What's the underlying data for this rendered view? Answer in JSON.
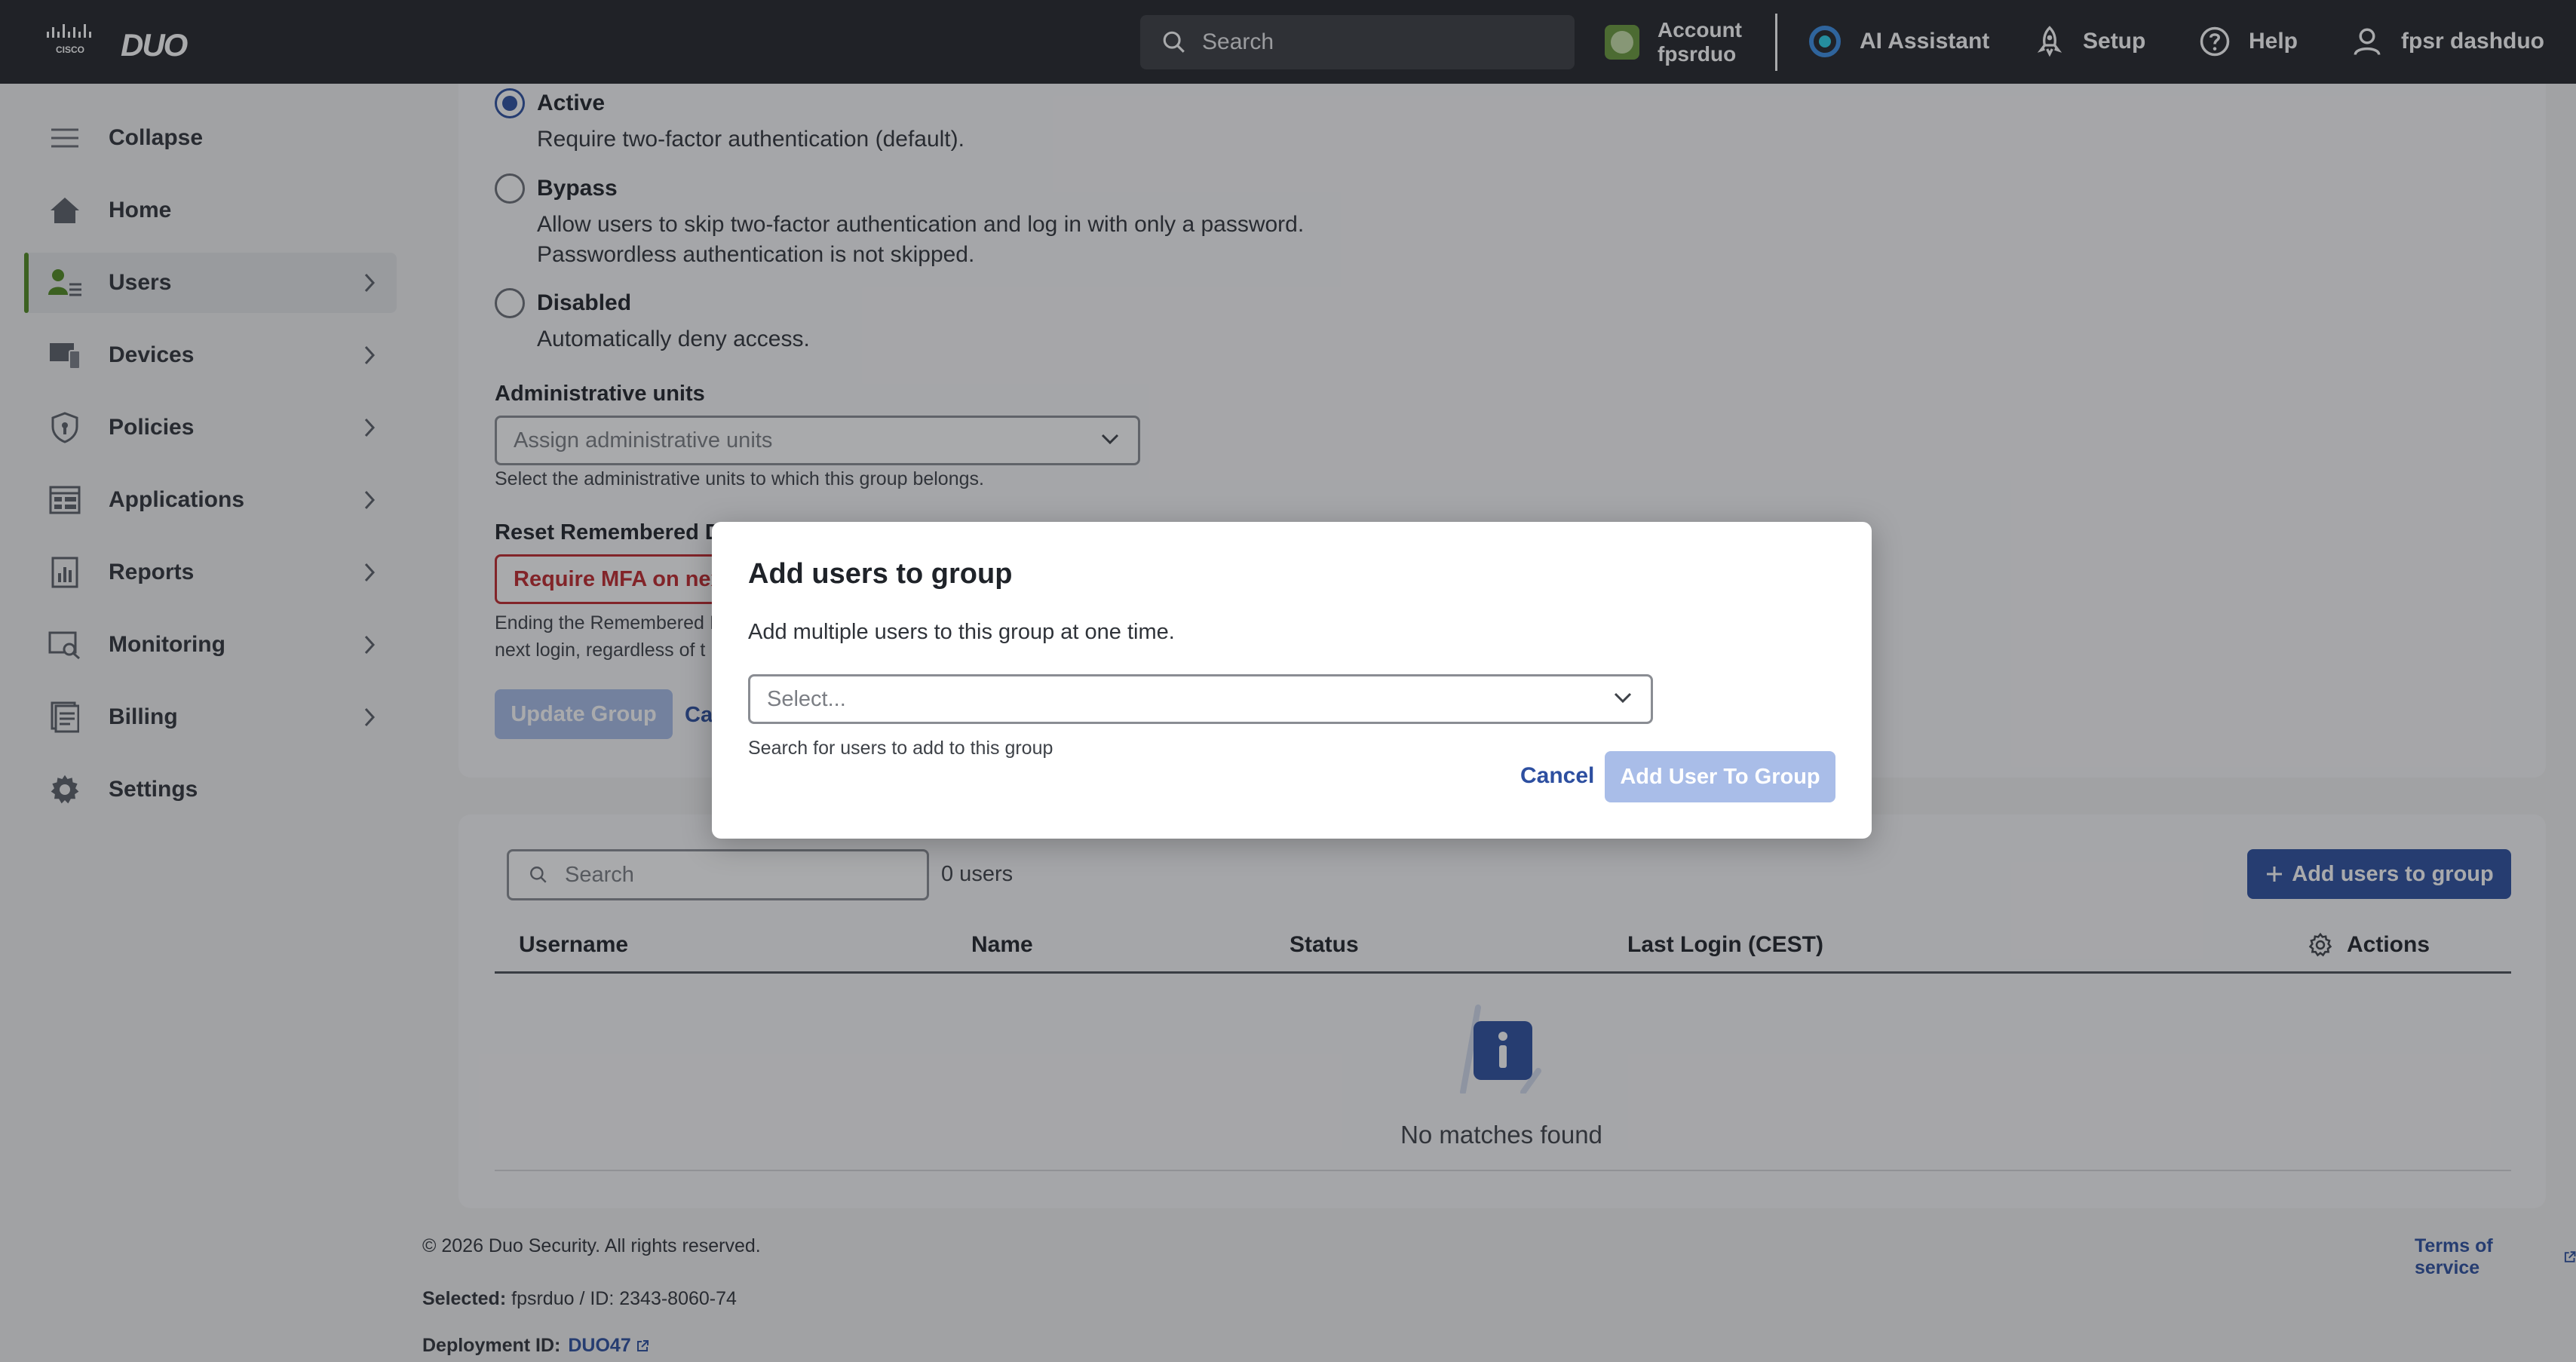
{
  "header": {
    "brand": "DUO",
    "search_placeholder": "Search",
    "account_label": "Account",
    "account_name": "fpsrduo",
    "ai_assistant": "AI Assistant",
    "setup": "Setup",
    "help": "Help",
    "user": "fpsr dashduo"
  },
  "sidebar": {
    "items": [
      {
        "label": "Collapse",
        "icon": "menu-icon"
      },
      {
        "label": "Home",
        "icon": "home-icon"
      },
      {
        "label": "Users",
        "icon": "users-icon",
        "active": true
      },
      {
        "label": "Devices",
        "icon": "devices-icon"
      },
      {
        "label": "Policies",
        "icon": "shield-icon"
      },
      {
        "label": "Applications",
        "icon": "applications-icon"
      },
      {
        "label": "Reports",
        "icon": "reports-icon"
      },
      {
        "label": "Monitoring",
        "icon": "monitoring-icon"
      },
      {
        "label": "Billing",
        "icon": "billing-icon"
      },
      {
        "label": "Settings",
        "icon": "gear-icon"
      }
    ]
  },
  "group_form": {
    "status_options": [
      {
        "title": "Active",
        "desc": "Require two-factor authentication (default).",
        "checked": true
      },
      {
        "title": "Bypass",
        "desc1": "Allow users to skip two-factor authentication and log in with only a password.",
        "desc2": "Passwordless authentication is not skipped."
      },
      {
        "title": "Disabled",
        "desc": "Automatically deny access."
      }
    ],
    "admin_units_label": "Administrative units",
    "admin_units_placeholder": "Assign administrative units",
    "admin_units_help": "Select the administrative units to which this group belongs.",
    "reset_label": "Reset Remembered D",
    "require_mfa_button": "Require MFA on nex",
    "reset_help1": "Ending the Remembered I",
    "reset_help2": "next login, regardless of t",
    "update_button": "Update Group",
    "cancel_link": "Ca"
  },
  "users_table": {
    "search_placeholder": "Search",
    "count": "0 users",
    "add_button": "Add users to group",
    "columns": [
      "Username",
      "Name",
      "Status",
      "Last Login (CEST)",
      "Actions"
    ],
    "empty_text": "No matches found"
  },
  "footer": {
    "copyright": "© 2026 Duo Security. All rights reserved.",
    "terms": "Terms of service",
    "selected_label": "Selected:",
    "selected_value": "fpsrduo / ID: 2343-8060-74",
    "deployment_label": "Deployment ID:",
    "deployment_value": "DUO47"
  },
  "modal": {
    "title": "Add users to group",
    "description": "Add multiple users to this group at one time.",
    "select_placeholder": "Select...",
    "help": "Search for users to add to this group",
    "cancel": "Cancel",
    "submit": "Add User To Group"
  },
  "colors": {
    "accent": "#2d4fa0",
    "danger": "#c0282d",
    "active_nav": "#4f8a1f",
    "topbar": "#232529"
  }
}
